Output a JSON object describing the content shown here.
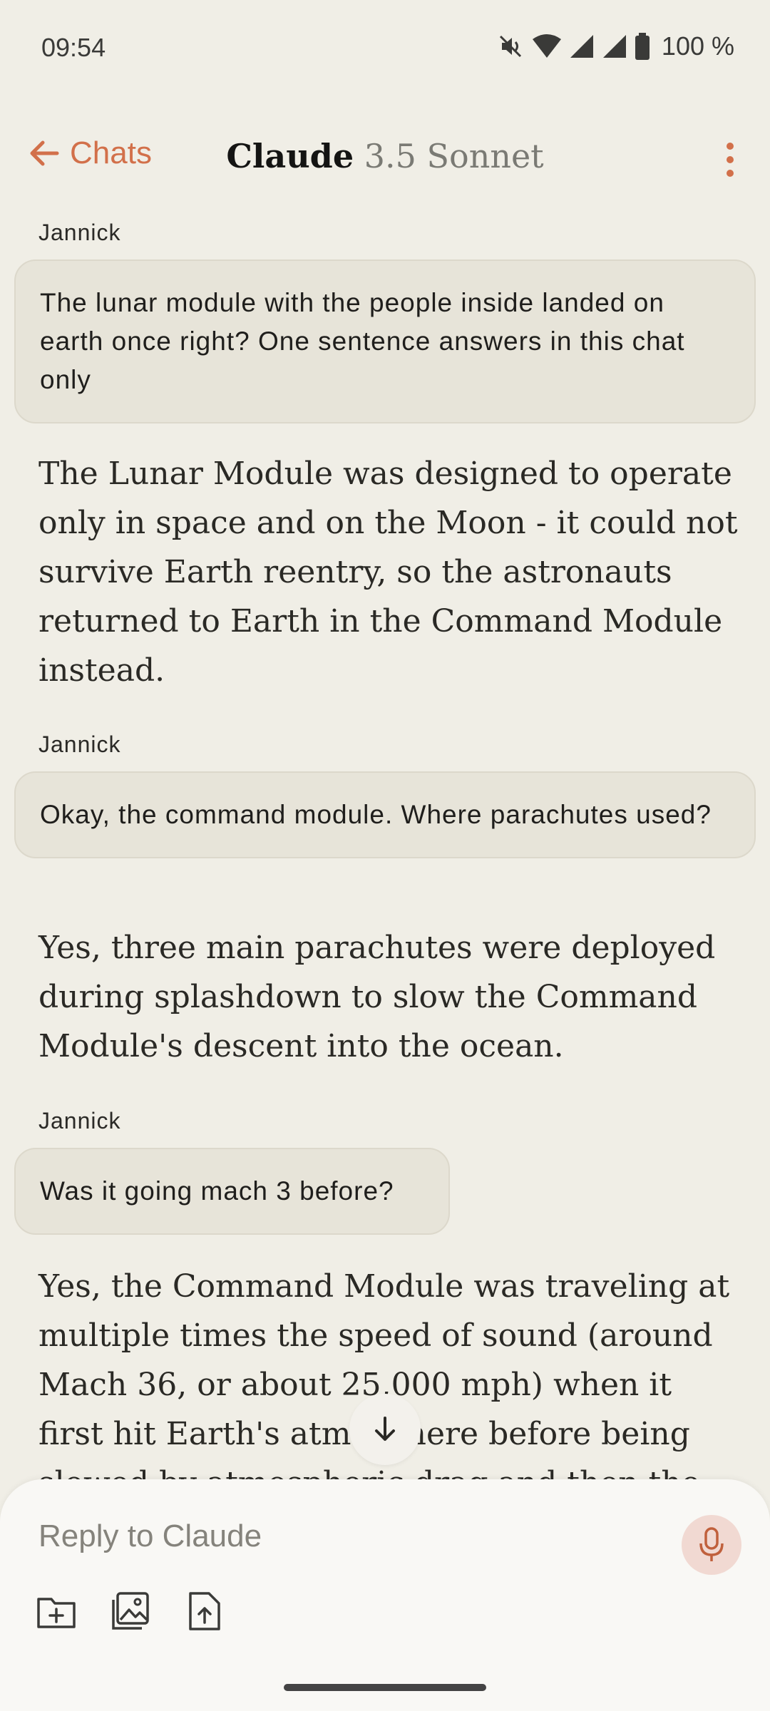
{
  "status_bar": {
    "time": "09:54",
    "battery": "100 %",
    "icons": [
      "mute-icon",
      "wifi-icon",
      "signal-icon",
      "signal-icon",
      "battery-icon"
    ]
  },
  "header": {
    "back_label": "Chats",
    "title": "Claude",
    "model": "3.5 Sonnet"
  },
  "messages": [
    {
      "sender": "Jannick",
      "text": "The lunar module with the people inside landed on earth once right? One sentence answers in this chat only"
    },
    {
      "reply": "The Lunar Module was designed to operate only in space and on the Moon - it could not survive Earth reentry, so the astronauts returned to Earth in the Command Module instead."
    },
    {
      "sender": "Jannick",
      "text": "Okay, the command module. Where parachutes used?"
    },
    {
      "reply": "Yes, three main parachutes were deployed during splashdown to slow the Command Module's descent into the ocean."
    },
    {
      "sender": "Jannick",
      "text": "Was it going mach 3 before?"
    },
    {
      "reply": "Yes, the Command Module was traveling at multiple times the speed of sound (around Mach 36, or about 25,000 mph) when it first hit Earth's atmosphere before being slowed by atmospheric drag and then the parachutes."
    }
  ],
  "composer": {
    "placeholder": "Reply to Claude",
    "tools": [
      "add-file-icon",
      "image-icon",
      "upload-icon"
    ]
  },
  "colors": {
    "background": "#F0EEE6",
    "accent": "#D2704A",
    "bubble": "#E7E4D9"
  }
}
